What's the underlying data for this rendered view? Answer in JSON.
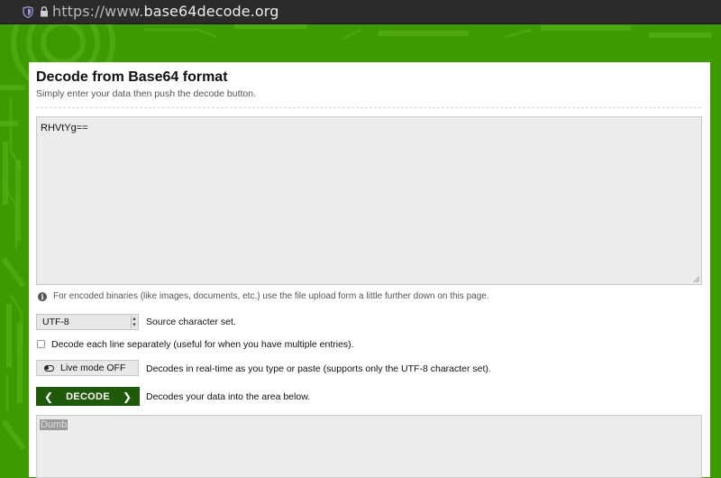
{
  "browser": {
    "url_scheme": "https://www.",
    "url_host": "base64decode.org"
  },
  "header": {
    "title": "Decode from Base64 format",
    "subtitle": "Simply enter your data then push the decode button."
  },
  "input": {
    "value": "RHVtYg=="
  },
  "info": {
    "text": "For encoded binaries (like images, documents, etc.) use the file upload form a little further down on this page."
  },
  "charset": {
    "selected": "UTF-8",
    "label": "Source character set."
  },
  "each_line": {
    "label": "Decode each line separately (useful for when you have multiple entries)."
  },
  "live_mode": {
    "button_label": "Live mode OFF",
    "description": "Decodes in real-time as you type or paste (supports only the UTF-8 character set)."
  },
  "decode": {
    "button_label": "DECODE",
    "description": "Decodes your data into the area below."
  },
  "output": {
    "value": "Dumb"
  },
  "colors": {
    "background": "#3d9a00",
    "decode_button": "#1f5a0a"
  }
}
